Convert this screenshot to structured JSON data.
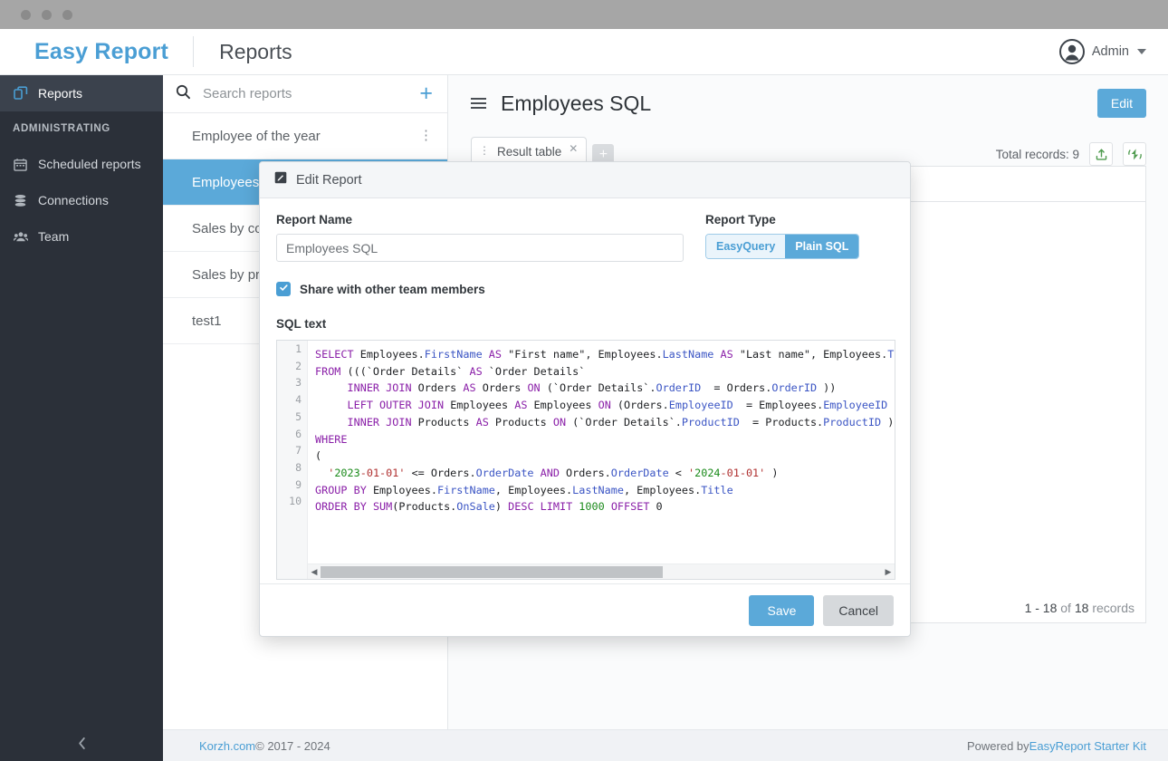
{
  "window": {
    "dots": 3
  },
  "header": {
    "brand": "Easy Report",
    "title": "Reports",
    "user": "Admin"
  },
  "sidebar": {
    "items": [
      {
        "label": "Reports",
        "icon": "reports-icon",
        "active": true
      }
    ],
    "section_label": "ADMINISTRATING",
    "admin_items": [
      {
        "label": "Scheduled reports",
        "icon": "calendar-icon"
      },
      {
        "label": "Connections",
        "icon": "database-icon"
      },
      {
        "label": "Team",
        "icon": "people-icon"
      }
    ],
    "collapse_icon": "chevron-left-icon"
  },
  "report_list": {
    "search_placeholder": "Search reports",
    "search_value": "",
    "add_icon": "plus-icon",
    "items": [
      {
        "label": "Employee of the year",
        "selected": false,
        "menu_icon": "kebab-menu-icon"
      },
      {
        "label": "Employees",
        "selected": true
      },
      {
        "label": "Sales by co",
        "selected": false
      },
      {
        "label": "Sales by pr",
        "selected": false
      },
      {
        "label": "test1",
        "selected": false
      }
    ]
  },
  "main": {
    "menu_icon": "hamburger-icon",
    "title": "Employees SQL",
    "edit_label": "Edit",
    "tab": {
      "label": "Result table",
      "grip_icon": "grip-icon",
      "close_icon": "close-icon"
    },
    "add_tab_icon": "plus-icon",
    "total_records": "Total records: 9",
    "export_icon": "export-icon",
    "refresh_icon": "refresh-icon",
    "pager": {
      "range": "1 - 18",
      "of": "of",
      "total": "18",
      "suffix": "records"
    }
  },
  "footer": {
    "copyright_link": "Korzh.com",
    "copyright_rest": " © 2017 - 2024",
    "powered_by": "Powered by ",
    "powered_link": "EasyReport Starter Kit"
  },
  "modal": {
    "icon": "edit-icon",
    "title": "Edit Report",
    "name_label": "Report Name",
    "name_value": "Employees SQL",
    "type_label": "Report Type",
    "type_options": [
      {
        "label": "EasyQuery",
        "active": false
      },
      {
        "label": "Plain SQL",
        "active": true
      }
    ],
    "share_label": "Share with other team members",
    "share_checked": true,
    "check_icon": "check-icon",
    "sql_label": "SQL text",
    "line_numbers": [
      "1",
      "2",
      "3",
      "4",
      "5",
      "6",
      "7",
      "8",
      "9",
      "10"
    ],
    "sql_lines": [
      "SELECT Employees.FirstName AS \"First name\", Employees.LastName AS \"Last name\", Employees.Title",
      "FROM (((`Order Details` AS `Order Details`",
      "     INNER JOIN Orders AS Orders ON (`Order Details`.OrderID  = Orders.OrderID ))",
      "     LEFT OUTER JOIN Employees AS Employees ON (Orders.EmployeeID  = Employees.EmployeeID ))",
      "     INNER JOIN Products AS Products ON (`Order Details`.ProductID  = Products.ProductID ))",
      "WHERE",
      "(",
      "  '2023-01-01' <= Orders.OrderDate AND Orders.OrderDate < '2024-01-01' )",
      "GROUP BY Employees.FirstName, Employees.LastName, Employees.Title",
      "ORDER BY SUM(Products.OnSale) DESC LIMIT 1000 OFFSET 0"
    ],
    "scroll_left_icon": "arrow-left-icon",
    "scroll_right_icon": "arrow-right-icon",
    "save_label": "Save",
    "cancel_label": "Cancel"
  },
  "colors": {
    "brand_blue": "#4a9ed4",
    "accent_blue": "#5ba9d9",
    "sidebar_bg": "#2b3039",
    "green": "#4f9b4f"
  }
}
